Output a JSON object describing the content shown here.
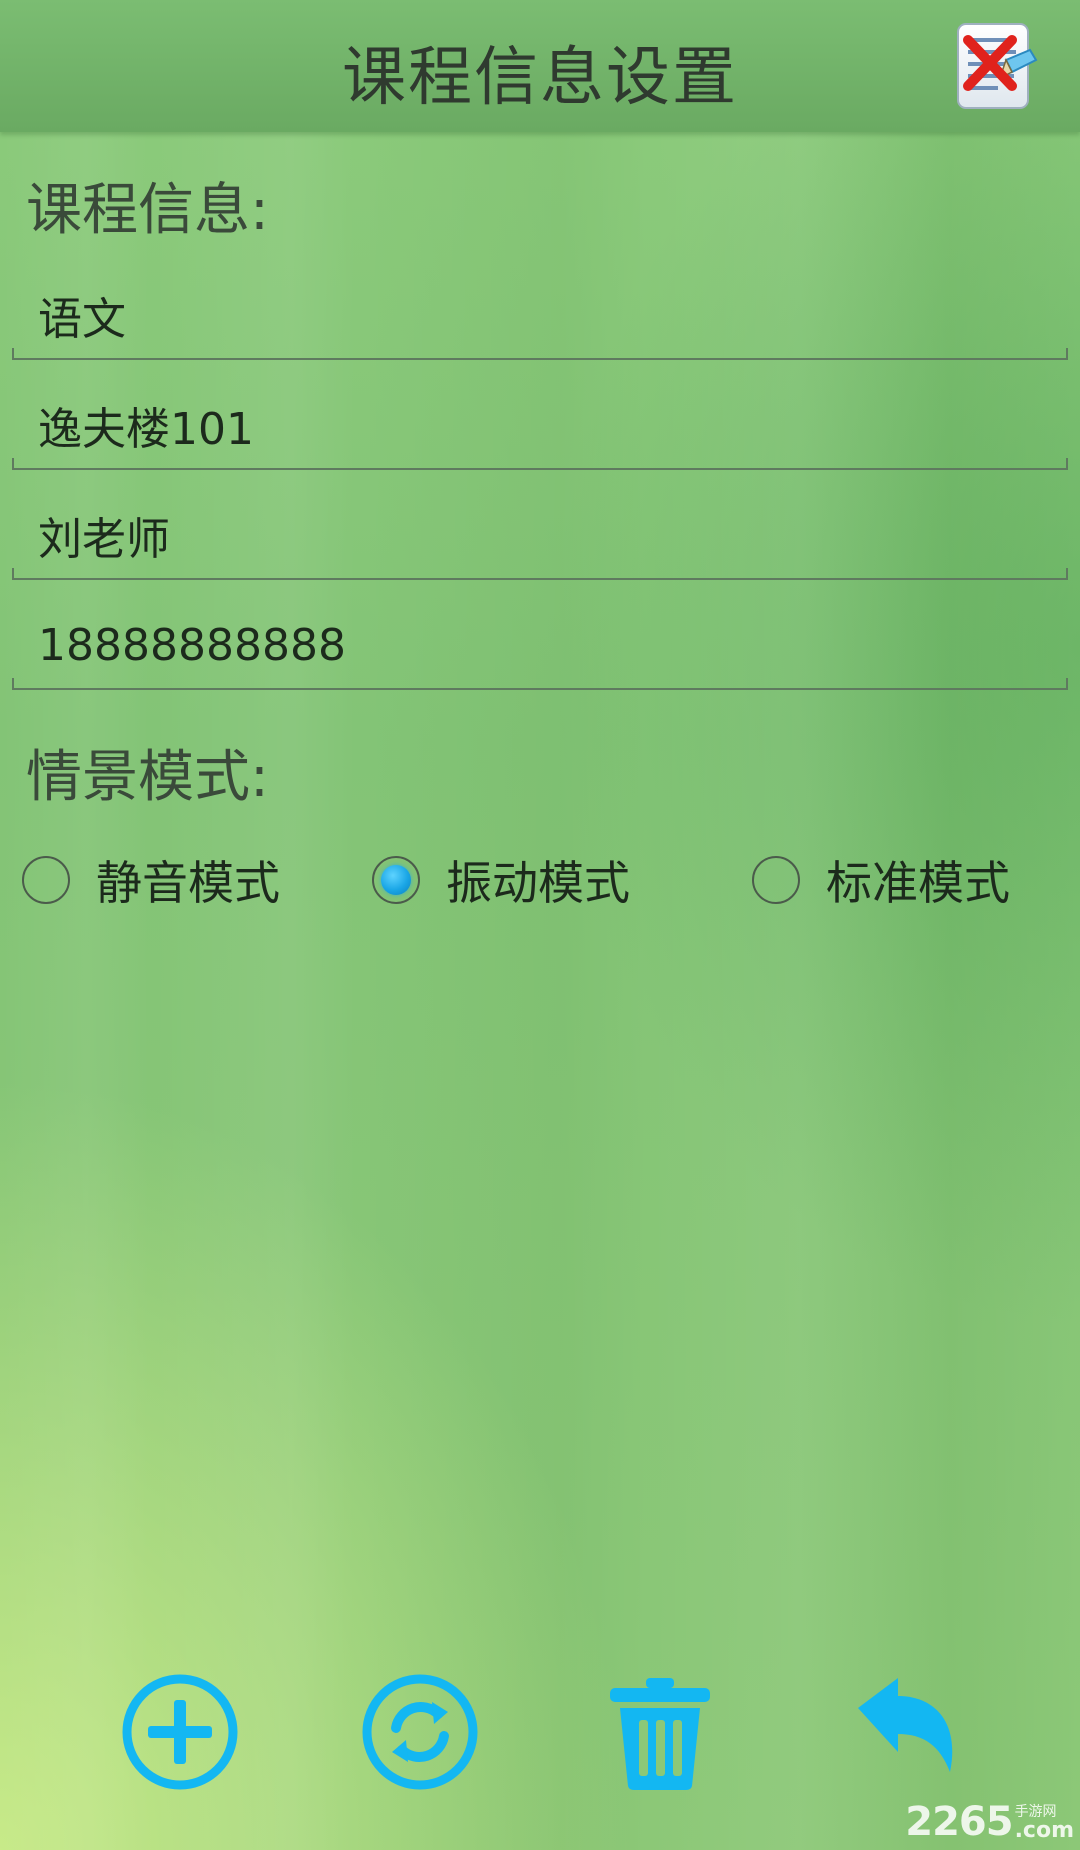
{
  "header": {
    "title": "课程信息设置"
  },
  "sections": {
    "course_info_label": "课程信息:",
    "mode_label": "情景模式:"
  },
  "fields": {
    "course_name": "语文",
    "location": "逸夫楼101",
    "teacher": "刘老师",
    "phone": "18888888888"
  },
  "modes": {
    "options": [
      "静音模式",
      "振动模式",
      "标准模式"
    ],
    "selected": "振动模式"
  },
  "toolbar": {
    "icons": [
      "add-icon",
      "refresh-icon",
      "trash-icon",
      "back-arrow-icon"
    ]
  },
  "colors": {
    "accent": "#1aa6e6",
    "header_bg": "#6aaa62"
  },
  "watermark": {
    "number": "2265",
    "top_text": "手游网",
    "bottom_text": ".com"
  }
}
